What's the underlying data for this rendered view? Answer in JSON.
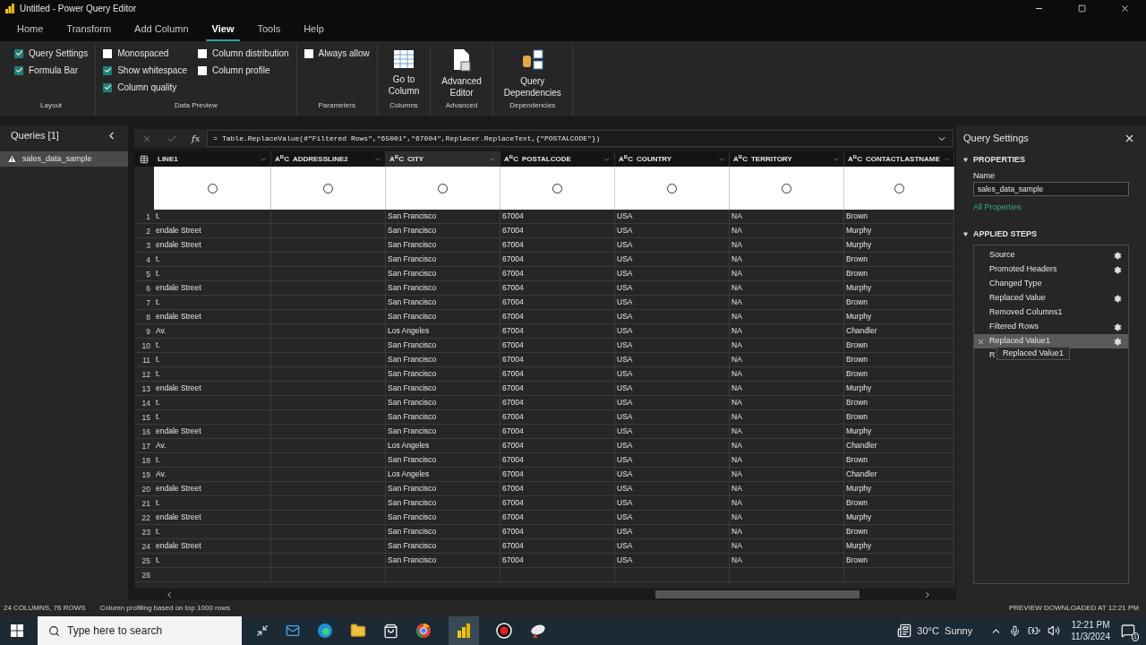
{
  "window": {
    "title": "Untitled - Power Query Editor"
  },
  "tabs": [
    {
      "label": "Home",
      "selected": false
    },
    {
      "label": "Transform",
      "selected": false
    },
    {
      "label": "Add Column",
      "selected": false
    },
    {
      "label": "View",
      "selected": true
    },
    {
      "label": "Tools",
      "selected": false
    },
    {
      "label": "Help",
      "selected": false
    }
  ],
  "ribbon": {
    "groups": [
      {
        "label": "Layout",
        "kind": "checks",
        "columns": [
          [
            {
              "label": "Query Settings",
              "checked": true
            },
            {
              "label": "Formula Bar",
              "checked": true
            }
          ]
        ]
      },
      {
        "label": "Data Preview",
        "kind": "checks",
        "columns": [
          [
            {
              "label": "Monospaced",
              "checked": false
            },
            {
              "label": "Show whitespace",
              "checked": true
            },
            {
              "label": "Column quality",
              "checked": true
            }
          ],
          [
            {
              "label": "Column distribution",
              "checked": false
            },
            {
              "label": "Column profile",
              "checked": false
            }
          ]
        ]
      },
      {
        "label": "Parameters",
        "kind": "checks",
        "columns": [
          [
            {
              "label": "Always allow",
              "checked": false
            }
          ]
        ]
      },
      {
        "label": "Columns",
        "kind": "table_button",
        "lines": [
          "Go to",
          "Column"
        ]
      },
      {
        "label": "Advanced",
        "kind": "document_button",
        "lines": [
          "Advanced",
          "Editor"
        ]
      },
      {
        "label": "Dependencies",
        "kind": "dependencies_button",
        "lines": [
          "Query",
          "Dependencies"
        ]
      }
    ]
  },
  "queries": {
    "title": "Queries [1]",
    "items": [
      {
        "name": "sales_data_sample",
        "selected": true,
        "warning": true
      }
    ]
  },
  "formula_bar": {
    "fx": "fx",
    "formula": "= Table.ReplaceValue(#\"Filtered Rows\",\"65001\",\"67004\",Replacer.ReplaceText,{\"POSTALCODE\"})"
  },
  "table": {
    "columns": [
      {
        "name": "LINE1",
        "selected": false
      },
      {
        "name": "ADDRESSLINE2",
        "type_mark": "A$^{B}$C",
        "selected": false
      },
      {
        "name": "CITY",
        "type_mark": "A$^{B}$C",
        "selected": true
      },
      {
        "name": "POSTALCODE",
        "type_mark": "A$^{B}$C",
        "selected": false
      },
      {
        "name": "COUNTRY",
        "type_mark": "A$^{B}$C",
        "selected": false
      },
      {
        "name": "TERRITORY",
        "type_mark": "A$^{B}$C",
        "selected": false
      },
      {
        "name": "CONTACTLASTNAME",
        "type_mark": "A$^{B}$C",
        "selected": false
      }
    ],
    "rows": [
      {
        "number": "1",
        "cells": [
          "t.",
          "",
          "San Francisco",
          "67004",
          "USA",
          "NA",
          "Brown"
        ]
      },
      {
        "number": "2",
        "cells": [
          "endale Street",
          "",
          "San Francisco",
          "67004",
          "USA",
          "NA",
          "Murphy"
        ]
      },
      {
        "number": "3",
        "cells": [
          "endale Street",
          "",
          "San Francisco",
          "67004",
          "USA",
          "NA",
          "Murphy"
        ]
      },
      {
        "number": "4",
        "cells": [
          "t.",
          "",
          "San Francisco",
          "67004",
          "USA",
          "NA",
          "Brown"
        ]
      },
      {
        "number": "5",
        "cells": [
          "t.",
          "",
          "San Francisco",
          "67004",
          "USA",
          "NA",
          "Brown"
        ]
      },
      {
        "number": "6",
        "cells": [
          "endale Street",
          "",
          "San Francisco",
          "67004",
          "USA",
          "NA",
          "Murphy"
        ]
      },
      {
        "number": "7",
        "cells": [
          "t.",
          "",
          "San Francisco",
          "67004",
          "USA",
          "NA",
          "Brown"
        ]
      },
      {
        "number": "8",
        "cells": [
          "endale Street",
          "",
          "San Francisco",
          "67004",
          "USA",
          "NA",
          "Murphy"
        ]
      },
      {
        "number": "9",
        "cells": [
          "Av.",
          "",
          "Los Angeles",
          "67004",
          "USA",
          "NA",
          "Chandler"
        ]
      },
      {
        "number": "10",
        "cells": [
          "t.",
          "",
          "San Francisco",
          "67004",
          "USA",
          "NA",
          "Brown"
        ]
      },
      {
        "number": "11",
        "cells": [
          "t.",
          "",
          "San Francisco",
          "67004",
          "USA",
          "NA",
          "Brown"
        ]
      },
      {
        "number": "12",
        "cells": [
          "t.",
          "",
          "San Francisco",
          "67004",
          "USA",
          "NA",
          "Brown"
        ]
      },
      {
        "number": "13",
        "cells": [
          "endale Street",
          "",
          "San Francisco",
          "67004",
          "USA",
          "NA",
          "Murphy"
        ]
      },
      {
        "number": "14",
        "cells": [
          "t.",
          "",
          "San Francisco",
          "67004",
          "USA",
          "NA",
          "Brown"
        ]
      },
      {
        "number": "15",
        "cells": [
          "t.",
          "",
          "San Francisco",
          "67004",
          "USA",
          "NA",
          "Brown"
        ]
      },
      {
        "number": "16",
        "cells": [
          "endale Street",
          "",
          "San Francisco",
          "67004",
          "USA",
          "NA",
          "Murphy"
        ]
      },
      {
        "number": "17",
        "cells": [
          "Av.",
          "",
          "Los Angeles",
          "67004",
          "USA",
          "NA",
          "Chandler"
        ]
      },
      {
        "number": "18",
        "cells": [
          "t.",
          "",
          "San Francisco",
          "67004",
          "USA",
          "NA",
          "Brown"
        ]
      },
      {
        "number": "19",
        "cells": [
          "Av.",
          "",
          "Los Angeles",
          "67004",
          "USA",
          "NA",
          "Chandler"
        ]
      },
      {
        "number": "20",
        "cells": [
          "endale Street",
          "",
          "San Francisco",
          "67004",
          "USA",
          "NA",
          "Murphy"
        ]
      },
      {
        "number": "21",
        "cells": [
          "t.",
          "",
          "San Francisco",
          "67004",
          "USA",
          "NA",
          "Brown"
        ]
      },
      {
        "number": "22",
        "cells": [
          "endale Street",
          "",
          "San Francisco",
          "67004",
          "USA",
          "NA",
          "Murphy"
        ]
      },
      {
        "number": "23",
        "cells": [
          "t.",
          "",
          "San Francisco",
          "67004",
          "USA",
          "NA",
          "Brown"
        ]
      },
      {
        "number": "24",
        "cells": [
          "endale Street",
          "",
          "San Francisco",
          "67004",
          "USA",
          "NA",
          "Murphy"
        ]
      },
      {
        "number": "25",
        "cells": [
          "t.",
          "",
          "San Francisco",
          "67004",
          "USA",
          "NA",
          "Brown"
        ]
      },
      {
        "number": "26",
        "cells": [
          "",
          "",
          "",
          "",
          "",
          "",
          ""
        ]
      }
    ]
  },
  "query_settings": {
    "title": "Query Settings",
    "properties_heading": "PROPERTIES",
    "name_label": "Name",
    "name_value": "sales_data_sample",
    "all_properties": "All Properties",
    "steps_heading": "APPLIED STEPS",
    "steps": [
      {
        "name": "Source",
        "settings": true,
        "selected": false
      },
      {
        "name": "Promoted Headers",
        "settings": true,
        "selected": false
      },
      {
        "name": "Changed Type",
        "settings": false,
        "selected": false
      },
      {
        "name": "Replaced Value",
        "settings": true,
        "selected": false
      },
      {
        "name": "Removed Columns1",
        "settings": false,
        "selected": false
      },
      {
        "name": "Filtered Rows",
        "settings": true,
        "selected": false
      },
      {
        "name": "Replaced Value1",
        "settings": true,
        "selected": true
      },
      {
        "name": "R",
        "settings": false,
        "selected": false
      }
    ],
    "tooltip": "Replaced Value1"
  },
  "status_bar": {
    "left": [
      "24 COLUMNS, 76 ROWS",
      "Column profiling based on top 1000 rows"
    ],
    "right": "PREVIEW DOWNLOADED AT 12:21 PM"
  },
  "taskbar": {
    "search_placeholder": "Type here to search",
    "weather": "30°C  Sunny",
    "time": "12:21 PM",
    "date": "11/3/2024",
    "notifications": "1"
  }
}
